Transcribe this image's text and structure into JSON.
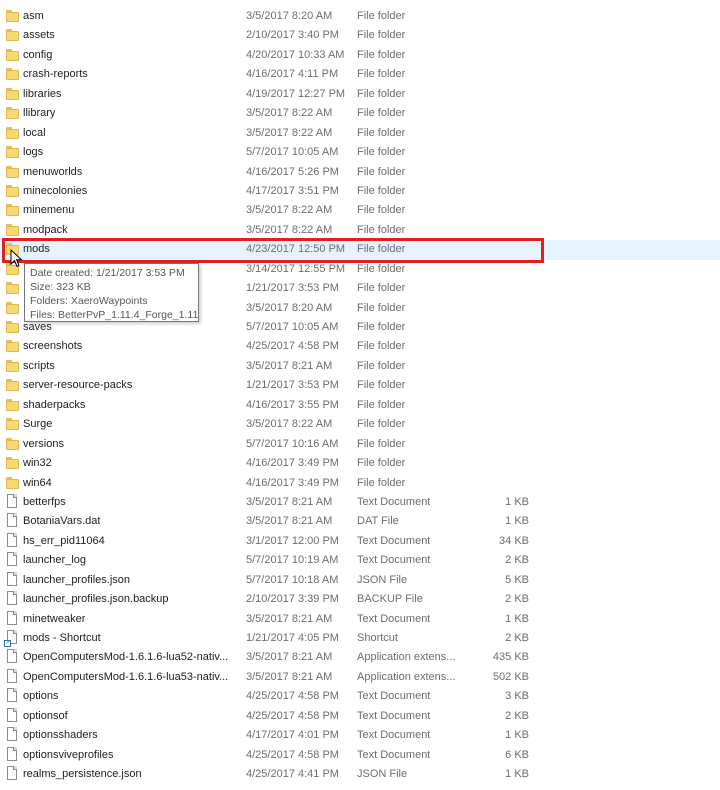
{
  "files": [
    {
      "name": "asm",
      "date": "3/5/2017 8:20 AM",
      "type": "File folder",
      "size": "",
      "icon": "folder"
    },
    {
      "name": "assets",
      "date": "2/10/2017 3:40 PM",
      "type": "File folder",
      "size": "",
      "icon": "folder"
    },
    {
      "name": "config",
      "date": "4/20/2017 10:33 AM",
      "type": "File folder",
      "size": "",
      "icon": "folder"
    },
    {
      "name": "crash-reports",
      "date": "4/16/2017 4:11 PM",
      "type": "File folder",
      "size": "",
      "icon": "folder"
    },
    {
      "name": "libraries",
      "date": "4/19/2017 12:27 PM",
      "type": "File folder",
      "size": "",
      "icon": "folder"
    },
    {
      "name": "llibrary",
      "date": "3/5/2017 8:22 AM",
      "type": "File folder",
      "size": "",
      "icon": "folder"
    },
    {
      "name": "local",
      "date": "3/5/2017 8:22 AM",
      "type": "File folder",
      "size": "",
      "icon": "folder"
    },
    {
      "name": "logs",
      "date": "5/7/2017 10:05 AM",
      "type": "File folder",
      "size": "",
      "icon": "folder"
    },
    {
      "name": "menuworlds",
      "date": "4/16/2017 5:26 PM",
      "type": "File folder",
      "size": "",
      "icon": "folder"
    },
    {
      "name": "minecolonies",
      "date": "4/17/2017 3:51 PM",
      "type": "File folder",
      "size": "",
      "icon": "folder"
    },
    {
      "name": "minemenu",
      "date": "3/5/2017 8:22 AM",
      "type": "File folder",
      "size": "",
      "icon": "folder"
    },
    {
      "name": "modpack",
      "date": "3/5/2017 8:22 AM",
      "type": "File folder",
      "size": "",
      "icon": "folder"
    },
    {
      "name": "mods",
      "date": "4/23/2017 12:50 PM",
      "type": "File folder",
      "size": "",
      "icon": "folder",
      "hover": true
    },
    {
      "name": "",
      "date": "3/14/2017 12:55 PM",
      "type": "File folder",
      "size": "",
      "icon": "folder"
    },
    {
      "name": "",
      "date": "1/21/2017 3:53 PM",
      "type": "File folder",
      "size": "",
      "icon": "folder"
    },
    {
      "name": "",
      "date": "3/5/2017 8:20 AM",
      "type": "File folder",
      "size": "",
      "icon": "folder"
    },
    {
      "name": "saves",
      "date": "5/7/2017 10:05 AM",
      "type": "File folder",
      "size": "",
      "icon": "folder"
    },
    {
      "name": "screenshots",
      "date": "4/25/2017 4:58 PM",
      "type": "File folder",
      "size": "",
      "icon": "folder"
    },
    {
      "name": "scripts",
      "date": "3/5/2017 8:21 AM",
      "type": "File folder",
      "size": "",
      "icon": "folder"
    },
    {
      "name": "server-resource-packs",
      "date": "1/21/2017 3:53 PM",
      "type": "File folder",
      "size": "",
      "icon": "folder"
    },
    {
      "name": "shaderpacks",
      "date": "4/16/2017 3:55 PM",
      "type": "File folder",
      "size": "",
      "icon": "folder"
    },
    {
      "name": "Surge",
      "date": "3/5/2017 8:22 AM",
      "type": "File folder",
      "size": "",
      "icon": "folder"
    },
    {
      "name": "versions",
      "date": "5/7/2017 10:16 AM",
      "type": "File folder",
      "size": "",
      "icon": "folder"
    },
    {
      "name": "win32",
      "date": "4/16/2017 3:49 PM",
      "type": "File folder",
      "size": "",
      "icon": "folder"
    },
    {
      "name": "win64",
      "date": "4/16/2017 3:49 PM",
      "type": "File folder",
      "size": "",
      "icon": "folder"
    },
    {
      "name": "betterfps",
      "date": "3/5/2017 8:21 AM",
      "type": "Text Document",
      "size": "1 KB",
      "icon": "document"
    },
    {
      "name": "BotaniaVars.dat",
      "date": "3/5/2017 8:21 AM",
      "type": "DAT File",
      "size": "1 KB",
      "icon": "document"
    },
    {
      "name": "hs_err_pid11064",
      "date": "3/1/2017 12:00 PM",
      "type": "Text Document",
      "size": "34 KB",
      "icon": "document"
    },
    {
      "name": "launcher_log",
      "date": "5/7/2017 10:19 AM",
      "type": "Text Document",
      "size": "2 KB",
      "icon": "document"
    },
    {
      "name": "launcher_profiles.json",
      "date": "5/7/2017 10:18 AM",
      "type": "JSON File",
      "size": "5 KB",
      "icon": "document"
    },
    {
      "name": "launcher_profiles.json.backup",
      "date": "2/10/2017 3:39 PM",
      "type": "BACKUP File",
      "size": "2 KB",
      "icon": "document"
    },
    {
      "name": "minetweaker",
      "date": "3/5/2017 8:21 AM",
      "type": "Text Document",
      "size": "1 KB",
      "icon": "document"
    },
    {
      "name": "mods - Shortcut",
      "date": "1/21/2017 4:05 PM",
      "type": "Shortcut",
      "size": "2 KB",
      "icon": "shortcut"
    },
    {
      "name": "OpenComputersMod-1.6.1.6-lua52-nativ...",
      "date": "3/5/2017 8:21 AM",
      "type": "Application extens...",
      "size": "435 KB",
      "icon": "document"
    },
    {
      "name": "OpenComputersMod-1.6.1.6-lua53-nativ...",
      "date": "3/5/2017 8:21 AM",
      "type": "Application extens...",
      "size": "502 KB",
      "icon": "document"
    },
    {
      "name": "options",
      "date": "4/25/2017 4:58 PM",
      "type": "Text Document",
      "size": "3 KB",
      "icon": "document"
    },
    {
      "name": "optionsof",
      "date": "4/25/2017 4:58 PM",
      "type": "Text Document",
      "size": "2 KB",
      "icon": "document"
    },
    {
      "name": "optionsshaders",
      "date": "4/17/2017 4:01 PM",
      "type": "Text Document",
      "size": "1 KB",
      "icon": "document"
    },
    {
      "name": "optionsviveprofiles",
      "date": "4/25/2017 4:58 PM",
      "type": "Text Document",
      "size": "6 KB",
      "icon": "document"
    },
    {
      "name": "realms_persistence.json",
      "date": "4/25/2017 4:41 PM",
      "type": "JSON File",
      "size": "1 KB",
      "icon": "document"
    }
  ],
  "tooltip": {
    "date_created": "Date created: 1/21/2017 3:53 PM",
    "size": "Size: 323 KB",
    "folders": "Folders: XaeroWaypoints",
    "files": "Files: BetterPvP_1.11.4_Forge_1.11"
  },
  "colors": {
    "highlight": "#e02020",
    "hover_row": "#e5f3ff",
    "folder": "#f8d775"
  }
}
